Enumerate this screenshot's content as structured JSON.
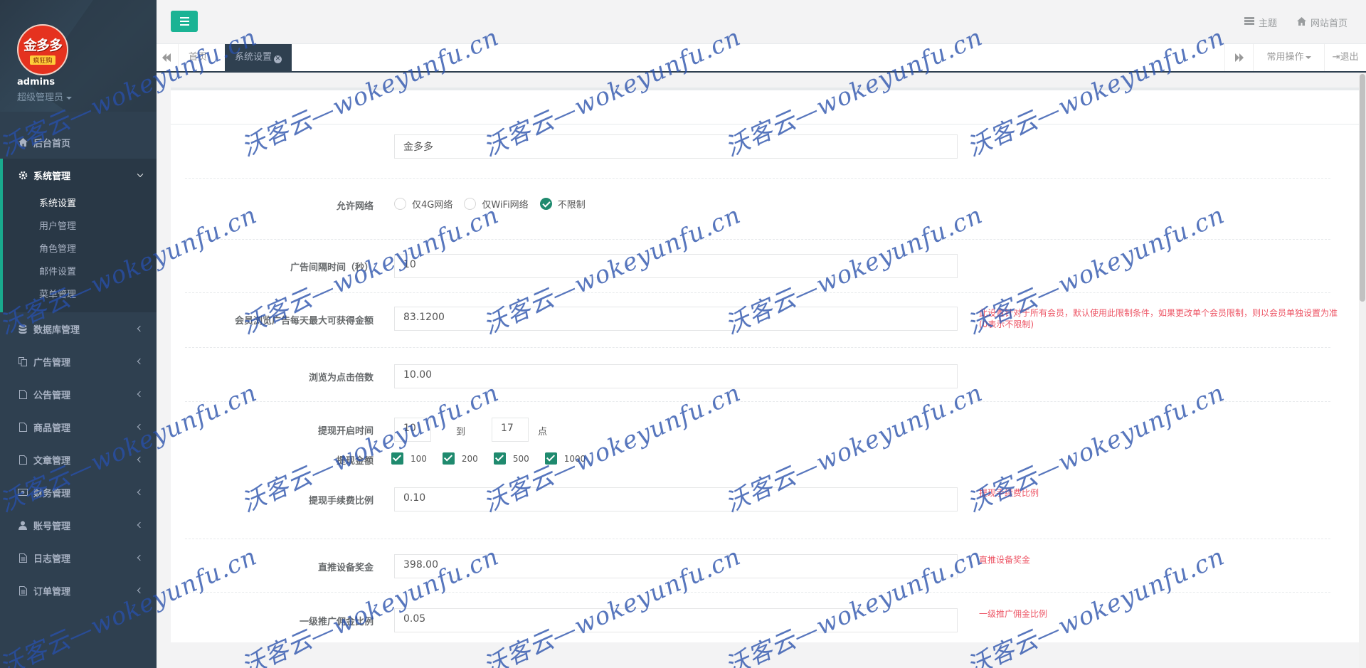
{
  "user": {
    "name": "admins",
    "role": "超级管理员",
    "logo_text": "金多多",
    "logo_sub": "疯狂购"
  },
  "menu": [
    {
      "label": "后台首页",
      "icon": "home-icon"
    },
    {
      "label": "系统管理",
      "icon": "gear-icon",
      "active": true
    },
    {
      "label": "数据库管理",
      "icon": "database-icon"
    },
    {
      "label": "广告管理",
      "icon": "copy-icon"
    },
    {
      "label": "公告管理",
      "icon": "file-icon"
    },
    {
      "label": "商品管理",
      "icon": "file-icon"
    },
    {
      "label": "文章管理",
      "icon": "file-icon"
    },
    {
      "label": "财务管理",
      "icon": "money-icon"
    },
    {
      "label": "账号管理",
      "icon": "user-icon"
    },
    {
      "label": "日志管理",
      "icon": "file-text-icon"
    },
    {
      "label": "订单管理",
      "icon": "file-text-icon"
    }
  ],
  "submenu": [
    "系统设置",
    "用户管理",
    "角色管理",
    "邮件设置",
    "菜单管理"
  ],
  "topbar": {
    "theme": "主题",
    "site_home": "网站首页"
  },
  "tabs": {
    "home": "首页",
    "active": "系统设置",
    "ops": "常用操作",
    "exit": "退出"
  },
  "form": {
    "site_name": "金多多",
    "network_label": "允许网络",
    "network_options": [
      "仅4G网络",
      "仅WiFi网络",
      "不限制"
    ],
    "ad_interval_label": "广告间隔时间（秒）",
    "ad_interval": "10",
    "max_amount_label": "会员浏览广告每天最大可获得金额",
    "max_amount": "83.1200",
    "max_amount_help": "此设置针对于所有会员，默认使用此限制条件，如果更改单个会员限制，则以会员单独设置为准(0表示不限制)",
    "click_ratio_label": "浏览为点击倍数",
    "click_ratio": "10.00",
    "withdraw_time_label": "提现开启时间",
    "withdraw_from": "10",
    "withdraw_to_word": "到",
    "withdraw_to": "17",
    "withdraw_unit": "点",
    "withdraw_amount_label": "提现金额",
    "withdraw_amounts": [
      "100",
      "200",
      "500",
      "1000"
    ],
    "fee_label": "提现手续费比例",
    "fee": "0.10",
    "fee_help": "提现手续费比例",
    "device_bonus_label": "直推设备奖金",
    "device_bonus": "398.00",
    "device_bonus_help": "直推设备奖金",
    "level1_label": "一级推广佣金比例",
    "level1": "0.05",
    "level1_help": "一级推广佣金比例"
  },
  "watermark": "沃客云—wokeyunfu.cn",
  "colors": {
    "sidebar": "#2f4050",
    "accent": "#1ab394",
    "help": "#ed5565"
  }
}
